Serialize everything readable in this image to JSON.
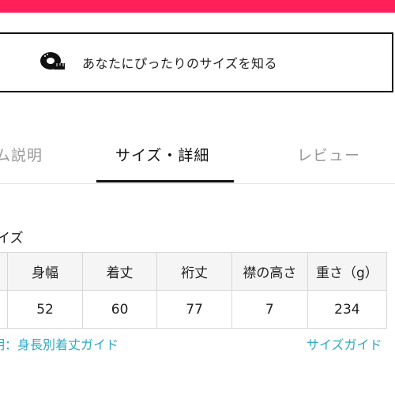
{
  "colors": {
    "accent": "#ff1f5a",
    "link": "#2fa9c4",
    "header_bg": "#f5f5f5",
    "border": "#d8d8d8"
  },
  "fit_button": {
    "icon": "tape-measure-icon",
    "label": "あなたにぴったりのサイズを知る"
  },
  "tabs": [
    {
      "label": "ム説明",
      "active": false
    },
    {
      "label": "サイズ・詳細",
      "active": true
    },
    {
      "label": "レビュー",
      "active": false
    }
  ],
  "section_title": "イズ",
  "size_table": {
    "headers": [
      "",
      "身幅",
      "着丈",
      "裄丈",
      "襟の高さ",
      "重さ（g）"
    ],
    "rows": [
      [
        "",
        "52",
        "60",
        "77",
        "7",
        "234"
      ]
    ]
  },
  "guide_links": {
    "left": "明：身長別着丈ガイド",
    "right": "サイズガイド"
  }
}
